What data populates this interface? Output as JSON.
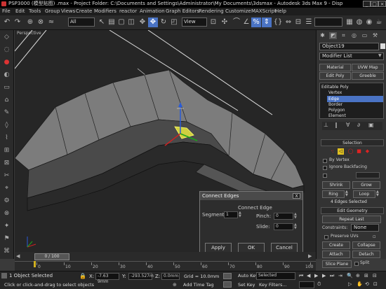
{
  "title_bar": {
    "text": "PSP3000 (模型贴图) .max   - Project Folder: C:\\Documents and Settings\\Administrator\\My Documents\\3dsmax   - Autodesk 3ds Max 9   - Disp",
    "controls": [
      "_",
      "□",
      "×"
    ]
  },
  "menu": [
    "File",
    "Edit",
    "Tools",
    "Group",
    "Views",
    "Create",
    "Modifiers",
    "reactor",
    "Animation",
    "Graph Editors",
    "Rendering",
    "Customize",
    "MAXScript",
    "Help"
  ],
  "toolbar": {
    "selection_filter": "All",
    "ref_coord": "View"
  },
  "viewport": {
    "label": "Perspective"
  },
  "connect_dialog": {
    "title": "Connect Edges",
    "close": "X",
    "group_label": "Connect Edge",
    "segments_label": "Segments:",
    "segments_value": "1",
    "pinch_label": "Pinch:",
    "pinch_value": "0",
    "slide_label": "Slide:",
    "slide_value": "0",
    "apply": "Apply",
    "ok": "OK",
    "cancel": "Cancel"
  },
  "command_panel": {
    "object_name": "Object19",
    "modifier_list": "Modifier List",
    "buttons": [
      "Material",
      "UVW Map",
      "Edit Poly",
      "Greeble"
    ],
    "stack": [
      "Editable Poly",
      "Vertex",
      "Edge",
      "Border",
      "Polygon",
      "Element"
    ],
    "selection_title": "Selection",
    "by_vertex": "By Vertex",
    "ignore_backfacing": "Ignore Backfacing",
    "shrink": "Shrink",
    "grow": "Grow",
    "ring": "Ring",
    "loop": "Loop",
    "selected_count": "4 Edges Selected",
    "edit_geometry_title": "Edit Geometry",
    "repeat_last": "Repeat Last",
    "constraints_label": "Constraints:",
    "constraints_value": "None",
    "preserve_uvs": "Preserve UVs",
    "create": "Create",
    "collapse": "Collapse",
    "attach": "Attach",
    "detach": "Detach",
    "slice_plane": "Slice Plane",
    "split": "Split"
  },
  "timeline": {
    "frame_label": "0 / 100",
    "ticks": [
      "0",
      "10",
      "20",
      "30",
      "40",
      "50",
      "60",
      "70",
      "80",
      "90",
      "100"
    ]
  },
  "status": {
    "selected": "1 Object Selected",
    "prompt": "Click or click-and-drag to select objects",
    "x_label": "X:",
    "x_value": "-7.63 9mm",
    "y_label": "Y:",
    "y_value": "-293.527m",
    "z_label": "Z:",
    "z_value": "0.0mm",
    "grid": "Grid = 10.0mm",
    "add_time_tag": "Add Time Tag",
    "auto_key": "Auto Key",
    "selected_dropdown": "Selected",
    "set_key": "Set Key",
    "key_filters": "Key Filters..."
  },
  "colors": {
    "selection_accent": "#4a73c4",
    "active_key": "#d0b020",
    "viewport_bg": "#262626",
    "mesh_light": "#7a7a7a",
    "mesh_dark": "#1c1c1c"
  }
}
